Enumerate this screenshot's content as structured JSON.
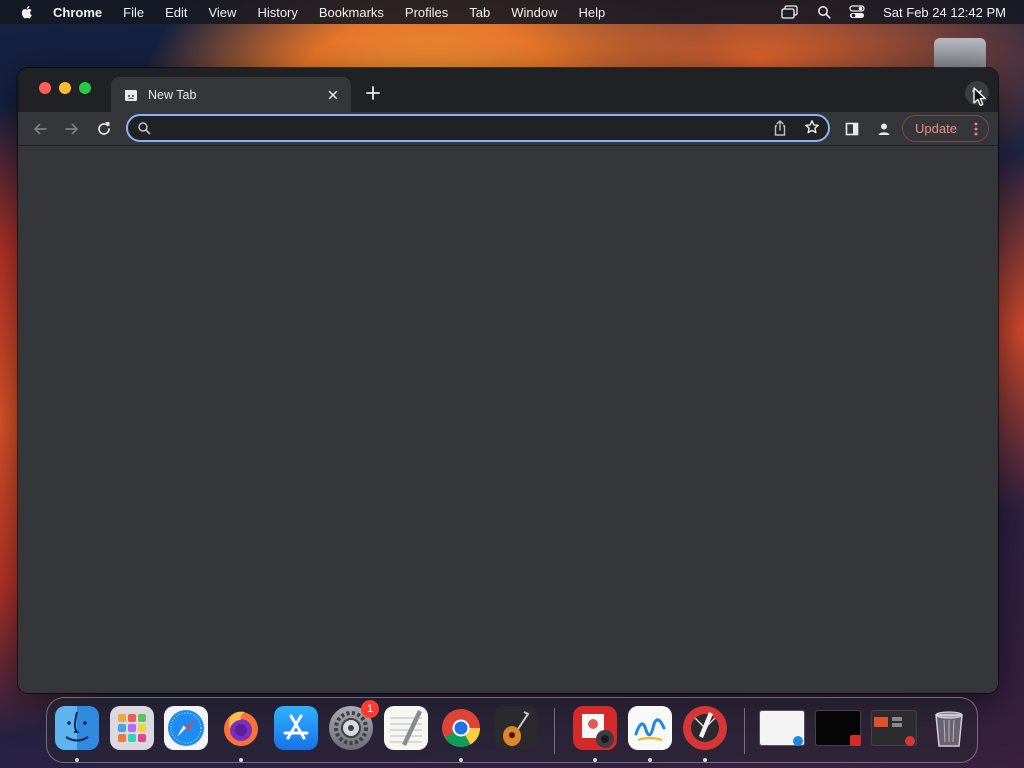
{
  "menubar": {
    "app_name": "Chrome",
    "items": [
      "File",
      "Edit",
      "View",
      "History",
      "Bookmarks",
      "Profiles",
      "Tab",
      "Window",
      "Help"
    ],
    "clock": "Sat Feb 24  12:42 PM",
    "status_icons": [
      "screen-mirroring-icon",
      "spotlight-search-icon",
      "control-center-icon"
    ]
  },
  "browser": {
    "tab_title": "New Tab",
    "omnibox": {
      "value": "",
      "placeholder": ""
    },
    "update_label": "Update"
  },
  "dock": {
    "apps": [
      {
        "name": "Finder",
        "running": true
      },
      {
        "name": "Launchpad",
        "running": false
      },
      {
        "name": "Safari",
        "running": false
      },
      {
        "name": "Firefox",
        "running": true
      },
      {
        "name": "App Store",
        "running": false
      },
      {
        "name": "System Preferences",
        "running": false,
        "badge": "1"
      },
      {
        "name": "TextEdit",
        "running": false
      },
      {
        "name": "Google Chrome",
        "running": true
      },
      {
        "name": "GarageBand",
        "running": false
      },
      {
        "name": "Photo Booth",
        "running": true
      },
      {
        "name": "Freeform",
        "running": true
      },
      {
        "name": "Digital Color Meter",
        "running": true
      }
    ],
    "recents": [
      "window-thumbnail-1",
      "window-thumbnail-2",
      "window-thumbnail-3"
    ],
    "trash": "Trash"
  },
  "colors": {
    "tab_bg": "#35363a",
    "tabstrip_bg": "#202124",
    "omnibox_focus": "#8ab4f8",
    "update_text": "#f28b82"
  }
}
